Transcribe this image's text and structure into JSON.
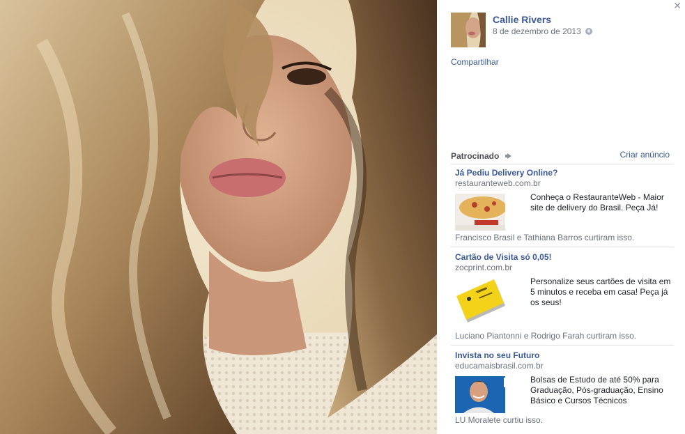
{
  "photo": {
    "icon": "woman-selfie-photo"
  },
  "close": {
    "label": "✕"
  },
  "post": {
    "author": "Callie Rivers",
    "date": "8 de dezembro de 2013",
    "share_label": "Compartilhar"
  },
  "sponsored": {
    "label": "Patrocinado",
    "create_ad": "Criar anúncio"
  },
  "ads": [
    {
      "title": "Já Pediu Delivery Online?",
      "domain": "restauranteweb.com.br",
      "text": "Conheça o RestauranteWeb - Maior site de delivery do Brasil. Peça Já!",
      "social": "Francisco Brasil e Tathiana Barros curtiram isso."
    },
    {
      "title": "Cartão de Visita só 0,05!",
      "domain": "zocprint.com.br",
      "text": "Personalize seus cartões de visita em 5 minutos e receba em casa! Peça já os seus!",
      "social": "Luciano Piantonni e Rodrigo Farah curtiram isso."
    },
    {
      "title": "Invista no seu Futuro",
      "domain": "educamaisbrasil.com.br",
      "text": "Bolsas de Estudo de até 50% para Graduação, Pós-graduação, Ensino Básico e Cursos Técnicos",
      "social": "LU Moralete curtiu isso."
    }
  ],
  "colors": {
    "link": "#3b5998",
    "meta": "#6a7180",
    "text": "#1d2129"
  }
}
